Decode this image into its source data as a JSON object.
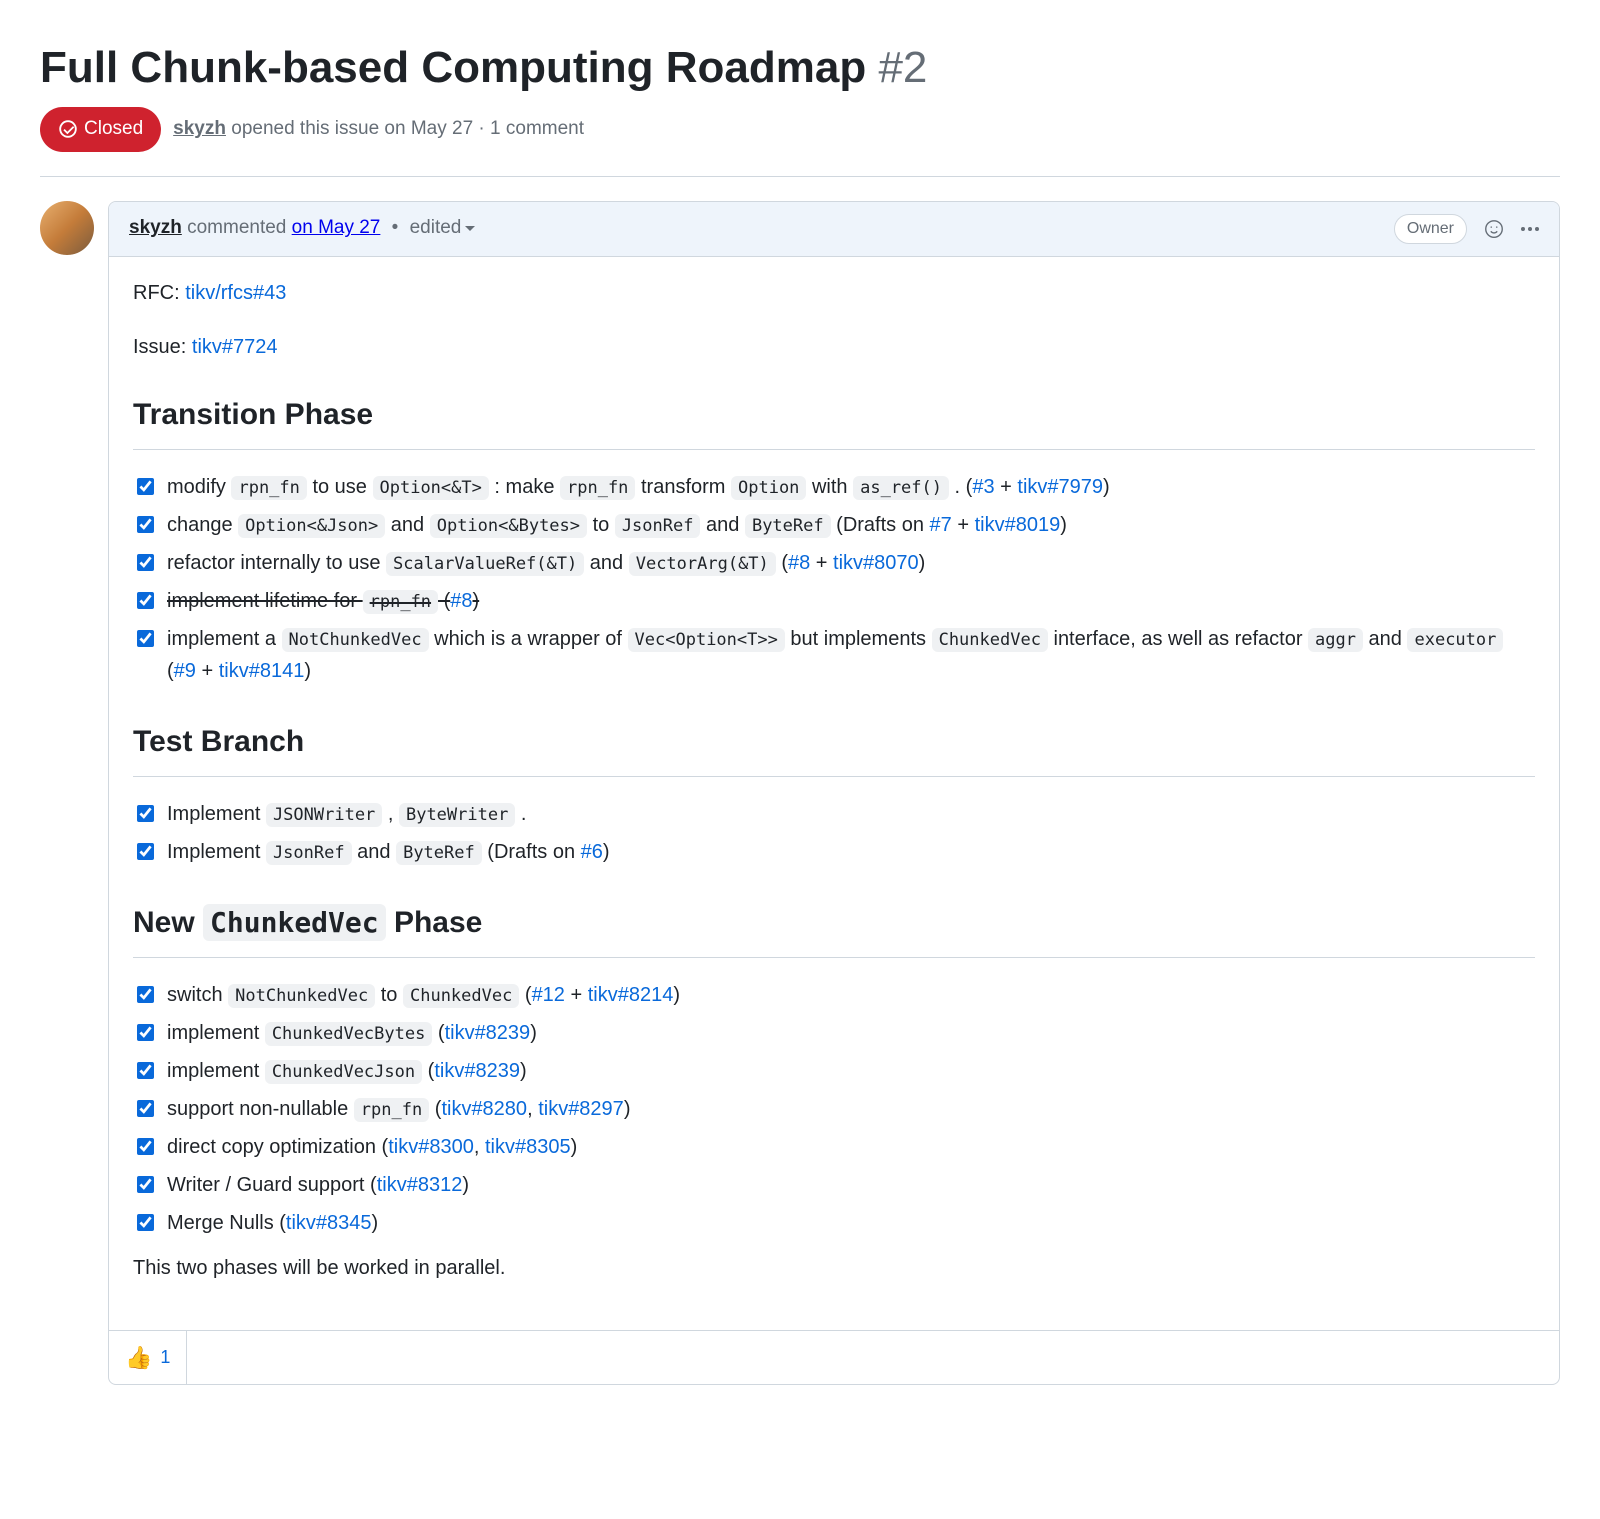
{
  "issue": {
    "title": "Full Chunk-based Computing Roadmap",
    "number": "#2",
    "state": "Closed",
    "author": "skyzh",
    "opened_text": "opened this issue",
    "opened_date": "on May 27",
    "comment_count": "1 comment"
  },
  "comment": {
    "author": "skyzh",
    "action": "commented",
    "date": "on May 27",
    "edited": "edited",
    "owner_label": "Owner",
    "rfc_prefix": "RFC: ",
    "rfc_link": "tikv/rfcs#43",
    "issue_prefix": "Issue: ",
    "issue_link": "tikv#7724",
    "h_transition": "Transition Phase",
    "h_test": "Test Branch",
    "h_new_pre": "New ",
    "h_new_code": "ChunkedVec",
    "h_new_post": " Phase",
    "footer": "This two phases will be worked in parallel.",
    "t1": {
      "a": {
        "pre": "modify ",
        "c1": "rpn_fn",
        "m1": " to use ",
        "c2": "Option<&T>",
        "m2": " : make ",
        "c3": "rpn_fn",
        "m3": " transform ",
        "c4": "Option",
        "m4": " with ",
        "c5": "as_ref()",
        "m5": " . (",
        "l1": "#3",
        "plus": " + ",
        "l2": "tikv#7979",
        "end": ")"
      },
      "b": {
        "pre": "change ",
        "c1": "Option<&Json>",
        "m1": " and ",
        "c2": "Option<&Bytes>",
        "m2": " to ",
        "c3": "JsonRef",
        "m3": " and ",
        "c4": "ByteRef",
        "m4": " (Drafts on ",
        "l1": "#7",
        "plus": " + ",
        "l2": "tikv#8019",
        "end": ")"
      },
      "c": {
        "pre": "refactor internally to use ",
        "c1": "ScalarValueRef(&T)",
        "m1": " and ",
        "c2": "VectorArg(&T)",
        "m2": " (",
        "l1": "#8",
        "plus": " + ",
        "l2": "tikv#8070",
        "end": ")"
      },
      "d": {
        "s1": "implement lifetime for ",
        "c1": "rpn_fn",
        "s2": " (",
        "l1": "#8",
        "s3": ")"
      },
      "e": {
        "pre": "implement a ",
        "c1": "NotChunkedVec",
        "m1": " which is a wrapper of ",
        "c2": "Vec<Option<T>>",
        "m2": " but implements ",
        "c3": "ChunkedVec",
        "m3": " interface, as well as refactor ",
        "c4": "aggr",
        "m4": " and ",
        "c5": "executor",
        "m5": " (",
        "l1": "#9",
        "plus": " + ",
        "l2": "tikv#8141",
        "end": ")"
      }
    },
    "t2": {
      "a": {
        "pre": "Implement ",
        "c1": "JSONWriter",
        "m1": " , ",
        "c2": "ByteWriter",
        "end": " ."
      },
      "b": {
        "pre": "Implement ",
        "c1": "JsonRef",
        "m1": " and ",
        "c2": "ByteRef",
        "m2": " (Drafts on ",
        "l1": "#6",
        "end": ")"
      }
    },
    "t3": {
      "a": {
        "pre": "switch ",
        "c1": "NotChunkedVec",
        "m1": " to ",
        "c2": "ChunkedVec",
        "m2": " (",
        "l1": "#12",
        "plus": " + ",
        "l2": "tikv#8214",
        "end": ")"
      },
      "b": {
        "pre": "implement ",
        "c1": "ChunkedVecBytes",
        "m1": " (",
        "l1": "tikv#8239",
        "end": ")"
      },
      "c": {
        "pre": "implement ",
        "c1": "ChunkedVecJson",
        "m1": " (",
        "l1": "tikv#8239",
        "end": ")"
      },
      "d": {
        "pre": "support non-nullable ",
        "c1": "rpn_fn",
        "m1": " (",
        "l1": "tikv#8280",
        "comma": ", ",
        "l2": "tikv#8297",
        "end": ")"
      },
      "e": {
        "pre": "direct copy optimization (",
        "l1": "tikv#8300",
        "comma": ", ",
        "l2": "tikv#8305",
        "end": ")"
      },
      "f": {
        "pre": "Writer / Guard support (",
        "l1": "tikv#8312",
        "end": ")"
      },
      "g": {
        "pre": "Merge Nulls (",
        "l1": "tikv#8345",
        "end": ")"
      }
    }
  },
  "reactions": {
    "thumbs_up_count": "1"
  }
}
